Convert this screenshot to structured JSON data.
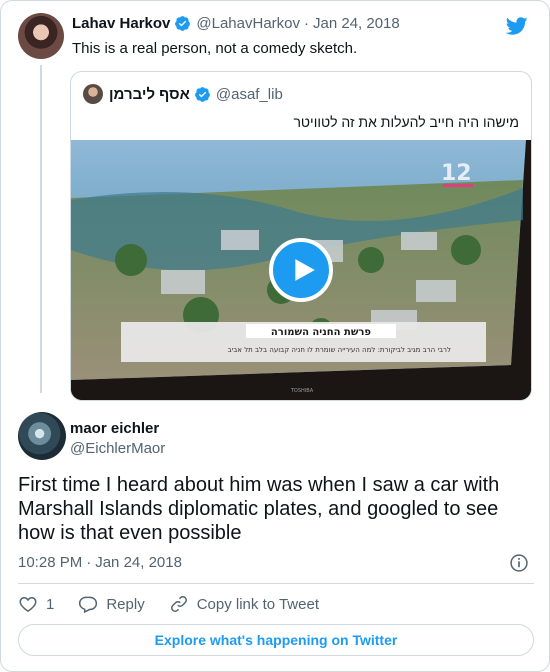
{
  "colors": {
    "accent": "#1d9bf0",
    "secondary_text": "#536471",
    "border": "#cfd9de"
  },
  "tweet1": {
    "author_name": "Lahav Harkov",
    "handle": "@LahavHarkov",
    "date": "Jan 24, 2018",
    "text": "This is a real person, not a comedy sketch.",
    "icons": {
      "verified": "verified-badge-icon",
      "brand": "twitter-bird-icon"
    }
  },
  "quoted": {
    "author_name": "אסף ליברמן",
    "handle": "@asaf_lib",
    "text": "מישהו היה חייב להעלות את זה לטוויטר",
    "video": {
      "channel_logo": "12",
      "banner_title": "פרשת החניה השמורה",
      "banner_subtitle": "לרבי הרב מגיב לביקורת: למה העירייה שומרת לו חניה קבועה בלב תל אביב",
      "tv_brand": "TOSHIBA",
      "play_icon": "play-icon"
    }
  },
  "reply": {
    "author_name": "maor eichler",
    "handle": "@EichlerMaor",
    "text": "First time I heard about him was when I saw a car with Marshall Islands diplomatic plates, and googled to see how  is that even possible",
    "time": "10:28 PM",
    "date": "Jan 24, 2018",
    "actions": {
      "like_count": "1",
      "reply_label": "Reply",
      "copy_label": "Copy link to Tweet"
    },
    "explore_label": "Explore what's happening on Twitter"
  }
}
